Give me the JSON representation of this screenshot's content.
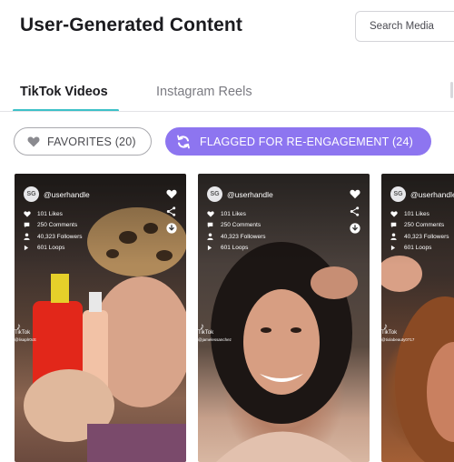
{
  "header": {
    "title": "User-Generated Content",
    "search_placeholder": "Search Media"
  },
  "tabs": [
    {
      "label": "TikTok Videos",
      "active": true
    },
    {
      "label": "Instagram Reels",
      "active": false
    }
  ],
  "filters": {
    "favorites_label": "FAVORITES (20)",
    "flagged_label": "FLAGGED FOR RE-ENGAGEMENT (24)"
  },
  "colors": {
    "accent_teal": "#3dc1c8",
    "flag_purple": "#8d75f0"
  },
  "cards": [
    {
      "avatar": "SG",
      "handle": "@userhandle",
      "likes": "101 Likes",
      "comments": "250 Comments",
      "followers": "40,323 Followers",
      "loops": "601 Loops",
      "platform": "TikTok",
      "source": "@lisaplr0ctt"
    },
    {
      "avatar": "SG",
      "handle": "@userhandle",
      "likes": "101 Likes",
      "comments": "250 Comments",
      "followers": "40,323 Followers",
      "loops": "601 Loops",
      "platform": "TikTok",
      "source": "@jamelessanchez"
    },
    {
      "avatar": "SG",
      "handle": "@userhandle",
      "likes": "101 Likes",
      "comments": "250 Comments",
      "followers": "40,323 Followers",
      "loops": "601 Loops",
      "platform": "TikTok",
      "source": "@tiolabeauty0717"
    }
  ]
}
